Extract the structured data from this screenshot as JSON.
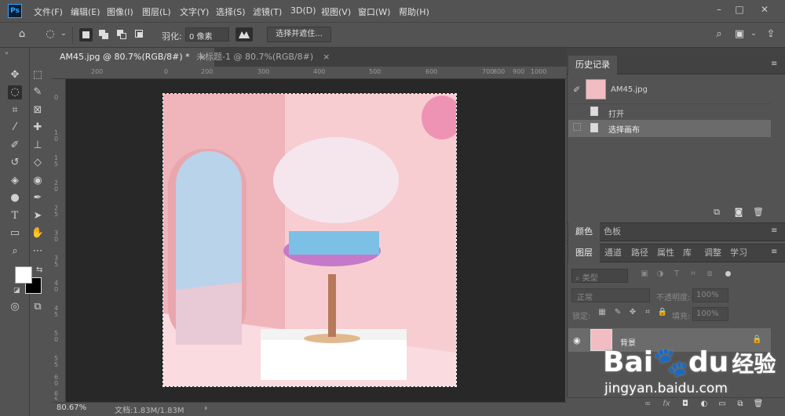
{
  "app": {
    "logo": "Ps"
  },
  "menu": [
    "文件(F)",
    "编辑(E)",
    "图像(I)",
    "图层(L)",
    "文字(Y)",
    "选择(S)",
    "滤镜(T)",
    "3D(D)",
    "视图(V)",
    "窗口(W)",
    "帮助(H)"
  ],
  "options": {
    "feather_label": "羽化:",
    "feather_value": "0 像素",
    "select_mask_label": "选择并遮住..."
  },
  "tabs": [
    {
      "label": "AM45.jpg @ 80.7%(RGB/8#) *",
      "close": "×"
    },
    {
      "label": "未标题-1 @ 80.7%(RGB/8#)",
      "close": "×"
    }
  ],
  "ruler": {
    "h_ticks": [
      "200",
      "0",
      "200",
      "300",
      "400",
      "500",
      "600",
      "700",
      "800",
      "900",
      "1000"
    ],
    "v_ticks": [
      "0",
      "1 0",
      "1 5",
      "2 0",
      "2 5",
      "3 0",
      "3 5",
      "4 0",
      "4 5",
      "5 0",
      "5 5",
      "6 0",
      "6 5"
    ]
  },
  "status": {
    "zoom": "80.67%",
    "doc": "文档:1.83M/1.83M",
    "arrow": "›"
  },
  "history": {
    "title": "历史记录",
    "snapshot_name": "AM45.jpg",
    "items": [
      "打开",
      "选择画布"
    ]
  },
  "color_panel": {
    "tabs": [
      "颜色",
      "色板"
    ]
  },
  "layers_panel": {
    "tabs": [
      "图层",
      "通道",
      "路径",
      "属性",
      "库",
      "调整",
      "学习"
    ],
    "filter_placeholder": "类型",
    "blend_mode": "正常",
    "opacity_label": "不透明度:",
    "opacity_value": "100%",
    "lock_label": "锁定:",
    "fill_label": "填充:",
    "fill_value": "100%",
    "layer_name": "背景"
  },
  "watermark": {
    "brand": "Bai",
    "brand2": "du",
    "cn": "经验",
    "url": "jingyan.baidu.com"
  }
}
